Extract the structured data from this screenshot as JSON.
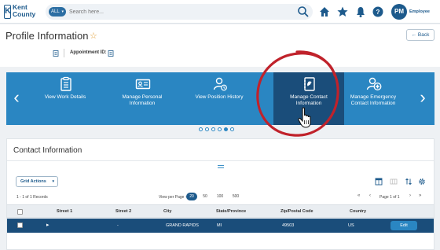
{
  "brand": {
    "line1": "Kent",
    "line2": "County",
    "letter": "K"
  },
  "search": {
    "scope": "ALL",
    "placeholder": "Search here..."
  },
  "user": {
    "initials": "PM",
    "role": "Employee"
  },
  "profile": {
    "title": "Profile Information",
    "appointment_label": "Appointment ID:",
    "back_label": "Back"
  },
  "carousel": {
    "tiles": [
      {
        "label": "View Work Details",
        "icon": "clipboard-icon",
        "active": false
      },
      {
        "label": "Manage Personal Information",
        "icon": "id-card-icon",
        "active": false
      },
      {
        "label": "View Position History",
        "icon": "user-history-icon",
        "active": false
      },
      {
        "label": "Manage Contact Information",
        "icon": "contact-book-icon",
        "active": true
      },
      {
        "label": "Manage Emergency Contact Information",
        "icon": "emergency-contact-icon",
        "active": false
      }
    ],
    "dots_total": 6,
    "dots_active": 4
  },
  "contact": {
    "title": "Contact Information",
    "grid_actions_label": "Grid Actions",
    "records_label": "1 - 1 of 1 Records",
    "view_per_page_label": "View per Page -",
    "page_sizes": [
      "20",
      "50",
      "100",
      "500"
    ],
    "selected_page_size": "20",
    "page_label": "Page 1 of 1",
    "columns": [
      "Street 1",
      "Street 2",
      "City",
      "State/Province",
      "Zip/Postal Code",
      "Country"
    ],
    "rows": [
      {
        "street1": "",
        "street2": "-",
        "city": "GRAND RAPIDS",
        "state": "MI",
        "zip": "49503",
        "country": "US"
      }
    ],
    "edit_label": "Edit"
  },
  "colors": {
    "primary": "#1a4d7a",
    "accent": "#2a86c2",
    "annotation": "#c0222b",
    "star": "#e09b2d"
  }
}
